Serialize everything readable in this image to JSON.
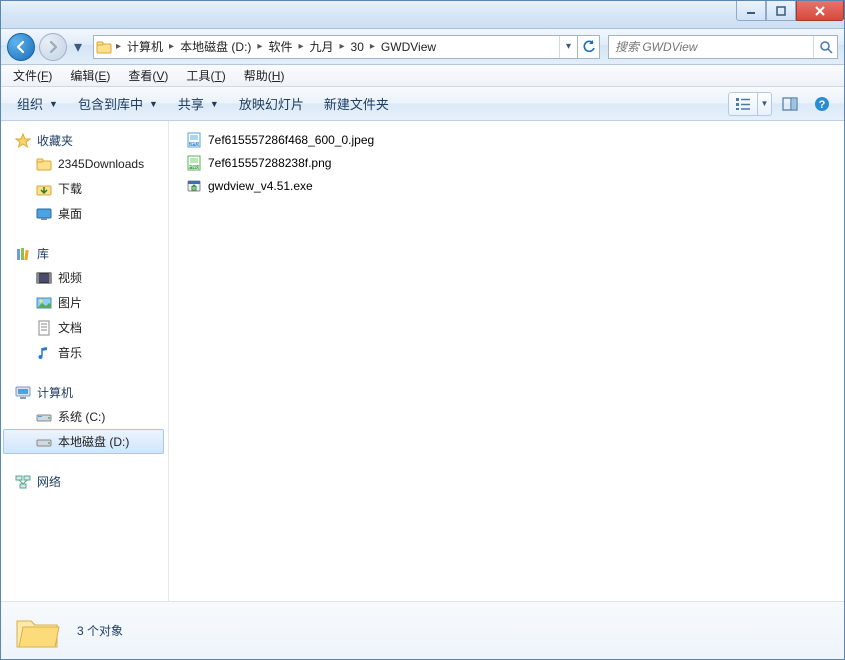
{
  "window": {
    "blurred_title": "　　　　　　　　　　　"
  },
  "win_controls": {
    "min": "–",
    "max": "□",
    "close": "×"
  },
  "breadcrumbs": {
    "items": [
      {
        "label": "计算机"
      },
      {
        "label": "本地磁盘 (D:)"
      },
      {
        "label": "软件"
      },
      {
        "label": "九月"
      },
      {
        "label": "30"
      },
      {
        "label": "GWDView"
      }
    ]
  },
  "search": {
    "placeholder": "搜索 GWDView"
  },
  "menus": {
    "file": {
      "label": "文件",
      "key": "F"
    },
    "edit": {
      "label": "编辑",
      "key": "E"
    },
    "view": {
      "label": "查看",
      "key": "V"
    },
    "tools": {
      "label": "工具",
      "key": "T"
    },
    "help": {
      "label": "帮助",
      "key": "H"
    }
  },
  "cmd": {
    "organize": "组织",
    "include": "包含到库中",
    "share": "共享",
    "slideshow": "放映幻灯片",
    "newfolder": "新建文件夹"
  },
  "sidebar": {
    "favorites": {
      "label": "收藏夹",
      "items": [
        {
          "label": "2345Downloads",
          "icon": "folder"
        },
        {
          "label": "下载",
          "icon": "download-folder"
        },
        {
          "label": "桌面",
          "icon": "desktop"
        }
      ]
    },
    "libraries": {
      "label": "库",
      "items": [
        {
          "label": "视频",
          "icon": "video"
        },
        {
          "label": "图片",
          "icon": "picture"
        },
        {
          "label": "文档",
          "icon": "document"
        },
        {
          "label": "音乐",
          "icon": "music"
        }
      ]
    },
    "computer": {
      "label": "计算机",
      "items": [
        {
          "label": "系统 (C:)",
          "icon": "drive-sys"
        },
        {
          "label": "本地磁盘 (D:)",
          "icon": "drive",
          "selected": true
        }
      ]
    },
    "network": {
      "label": "网络"
    }
  },
  "files": [
    {
      "name": "7ef615557286f468_600_0.jpeg",
      "icon": "jpeg"
    },
    {
      "name": "7ef615557288238f.png",
      "icon": "png"
    },
    {
      "name": "gwdview_v4.51.exe",
      "icon": "exe"
    }
  ],
  "details": {
    "count_text": "3 个对象"
  }
}
